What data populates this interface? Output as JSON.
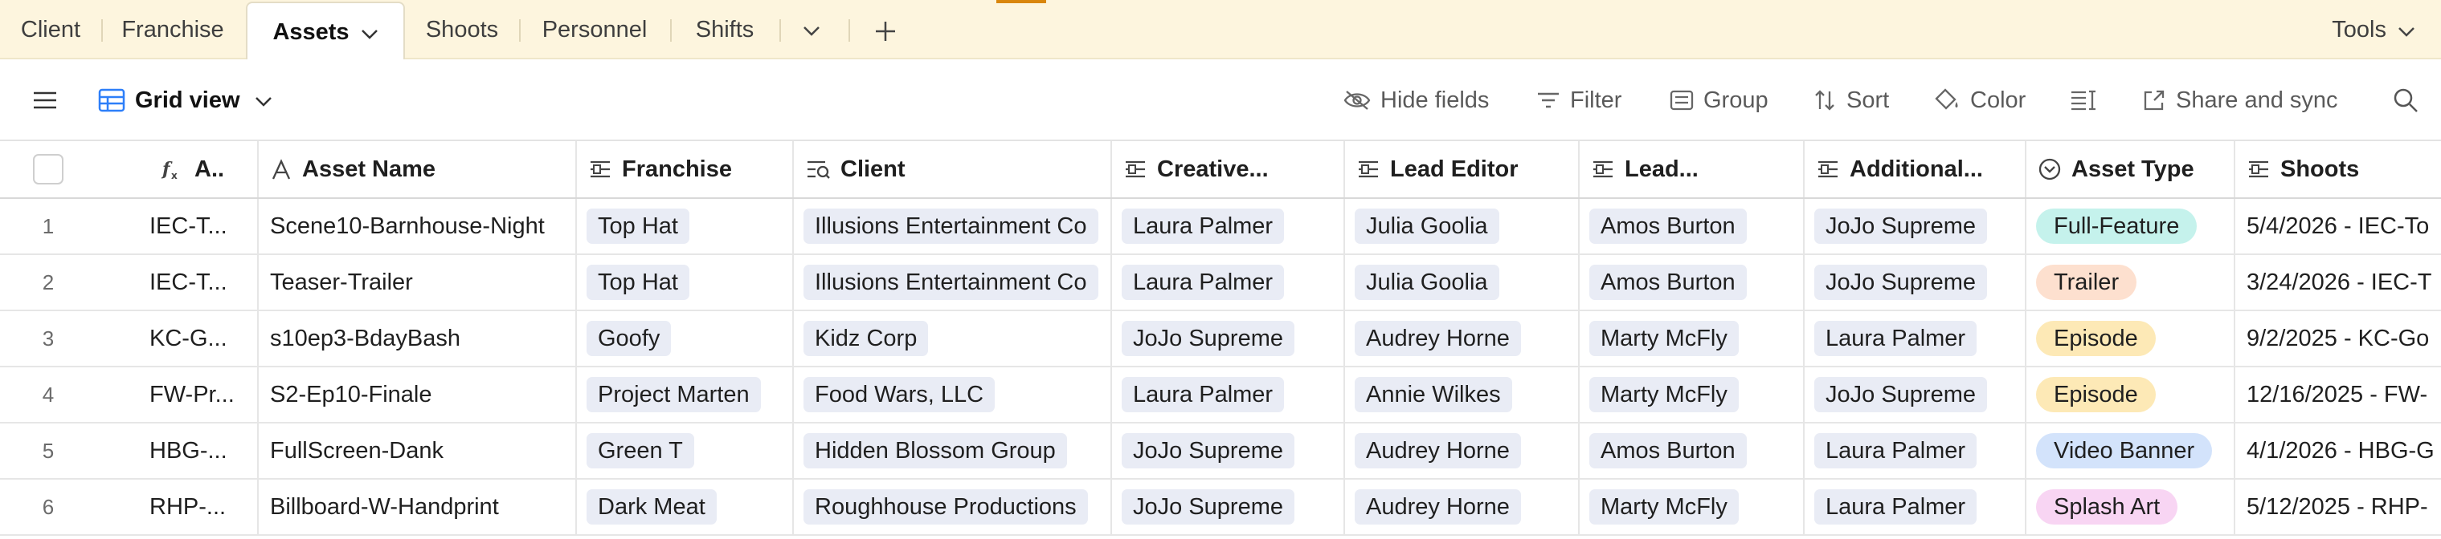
{
  "tabs": [
    {
      "label": "Client"
    },
    {
      "label": "Franchise"
    },
    {
      "label": "Assets"
    },
    {
      "label": "Shoots"
    },
    {
      "label": "Personnel"
    },
    {
      "label": "Shifts"
    }
  ],
  "tools_label": "Tools",
  "toolbar": {
    "view_label": "Grid view",
    "hide_fields": "Hide fields",
    "filter": "Filter",
    "group": "Group",
    "sort": "Sort",
    "color": "Color",
    "share": "Share and sync"
  },
  "columns": {
    "code": "A..",
    "asset_name": "Asset Name",
    "franchise": "Franchise",
    "client": "Client",
    "creative": "Creative...",
    "lead_editor": "Lead Editor",
    "lead": "Lead...",
    "additional": "Additional...",
    "asset_type": "Asset Type",
    "shoots": "Shoots"
  },
  "rows": [
    {
      "num": "1",
      "code": "IEC-T...",
      "asset_name": "Scene10-Barnhouse-Night",
      "franchise": "Top Hat",
      "client": "Illusions Entertainment Co",
      "creative": "Laura Palmer",
      "lead_editor": "Julia Goolia",
      "lead": "Amos Burton",
      "additional": "JoJo Supreme",
      "asset_type": "Full-Feature",
      "shoots": "5/4/2026 - IEC-To"
    },
    {
      "num": "2",
      "code": "IEC-T...",
      "asset_name": "Teaser-Trailer",
      "franchise": "Top Hat",
      "client": "Illusions Entertainment Co",
      "creative": "Laura Palmer",
      "lead_editor": "Julia Goolia",
      "lead": "Amos Burton",
      "additional": "JoJo Supreme",
      "asset_type": "Trailer",
      "shoots": "3/24/2026 - IEC-T"
    },
    {
      "num": "3",
      "code": "KC-G...",
      "asset_name": "s10ep3-BdayBash",
      "franchise": "Goofy",
      "client": "Kidz Corp",
      "creative": "JoJo Supreme",
      "lead_editor": "Audrey Horne",
      "lead": "Marty McFly",
      "additional": "Laura Palmer",
      "asset_type": "Episode",
      "shoots": "9/2/2025 - KC-Go"
    },
    {
      "num": "4",
      "code": "FW-Pr...",
      "asset_name": "S2-Ep10-Finale",
      "franchise": "Project Marten",
      "client": "Food Wars, LLC",
      "creative": "Laura Palmer",
      "lead_editor": "Annie Wilkes",
      "lead": "Marty McFly",
      "additional": "JoJo Supreme",
      "asset_type": "Episode",
      "shoots": "12/16/2025 - FW-"
    },
    {
      "num": "5",
      "code": "HBG-...",
      "asset_name": "FullScreen-Dank",
      "franchise": "Green T",
      "client": "Hidden Blossom Group",
      "creative": "JoJo Supreme",
      "lead_editor": "Audrey Horne",
      "lead": "Amos Burton",
      "additional": "Laura Palmer",
      "asset_type": "Video Banner",
      "shoots": "4/1/2026 - HBG-G"
    },
    {
      "num": "6",
      "code": "RHP-...",
      "asset_name": "Billboard-W-Handprint",
      "franchise": "Dark Meat",
      "client": "Roughhouse Productions",
      "creative": "JoJo Supreme",
      "lead_editor": "Audrey Horne",
      "lead": "Marty McFly",
      "additional": "Laura Palmer",
      "asset_type": "Splash Art",
      "shoots": "5/12/2025 - RHP-"
    }
  ],
  "asset_type_colors": {
    "Full-Feature": "#c5f2ec",
    "Trailer": "#fde0cf",
    "Episode": "#fde9b6",
    "Video Banner": "#d3e3fb",
    "Splash Art": "#f8d5f3"
  },
  "link_pill_color": "#e9ecf5",
  "accent_color": "#d9860c",
  "tabbar_color": "#fdf5de"
}
